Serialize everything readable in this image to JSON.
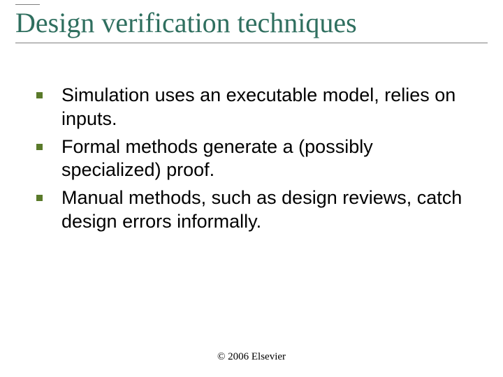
{
  "title": "Design verification techniques",
  "bullets": [
    "Simulation uses an executable model, relies on inputs.",
    "Formal methods generate a (possibly specialized) proof.",
    "Manual methods, such as design reviews, catch design errors informally."
  ],
  "footer": "© 2006 Elsevier"
}
